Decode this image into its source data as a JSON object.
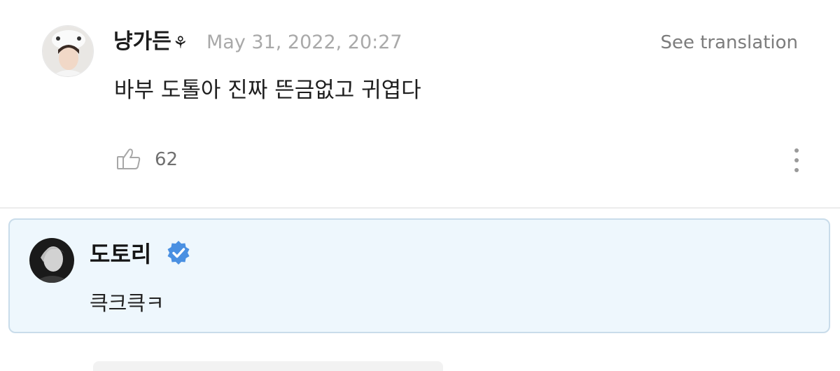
{
  "comment": {
    "username": "냥가든",
    "username_symbol": "⚘",
    "timestamp": "May 31, 2022, 20:27",
    "translate_label": "See translation",
    "body": "바부 도톨아 진짜 뜬금없고 귀엽다",
    "like_count": "62",
    "icons": {
      "like": "thumbs-up-icon",
      "more": "more-vertical-icon"
    }
  },
  "reply": {
    "username": "도토리",
    "body": "큭크큭ㅋ",
    "badge_icon": "verified-badge-icon",
    "badge_color": "#4a90e2"
  },
  "colors": {
    "reply_background": "#eef7fd",
    "reply_border": "#c9dcea",
    "muted_text": "#a9a9a9"
  }
}
